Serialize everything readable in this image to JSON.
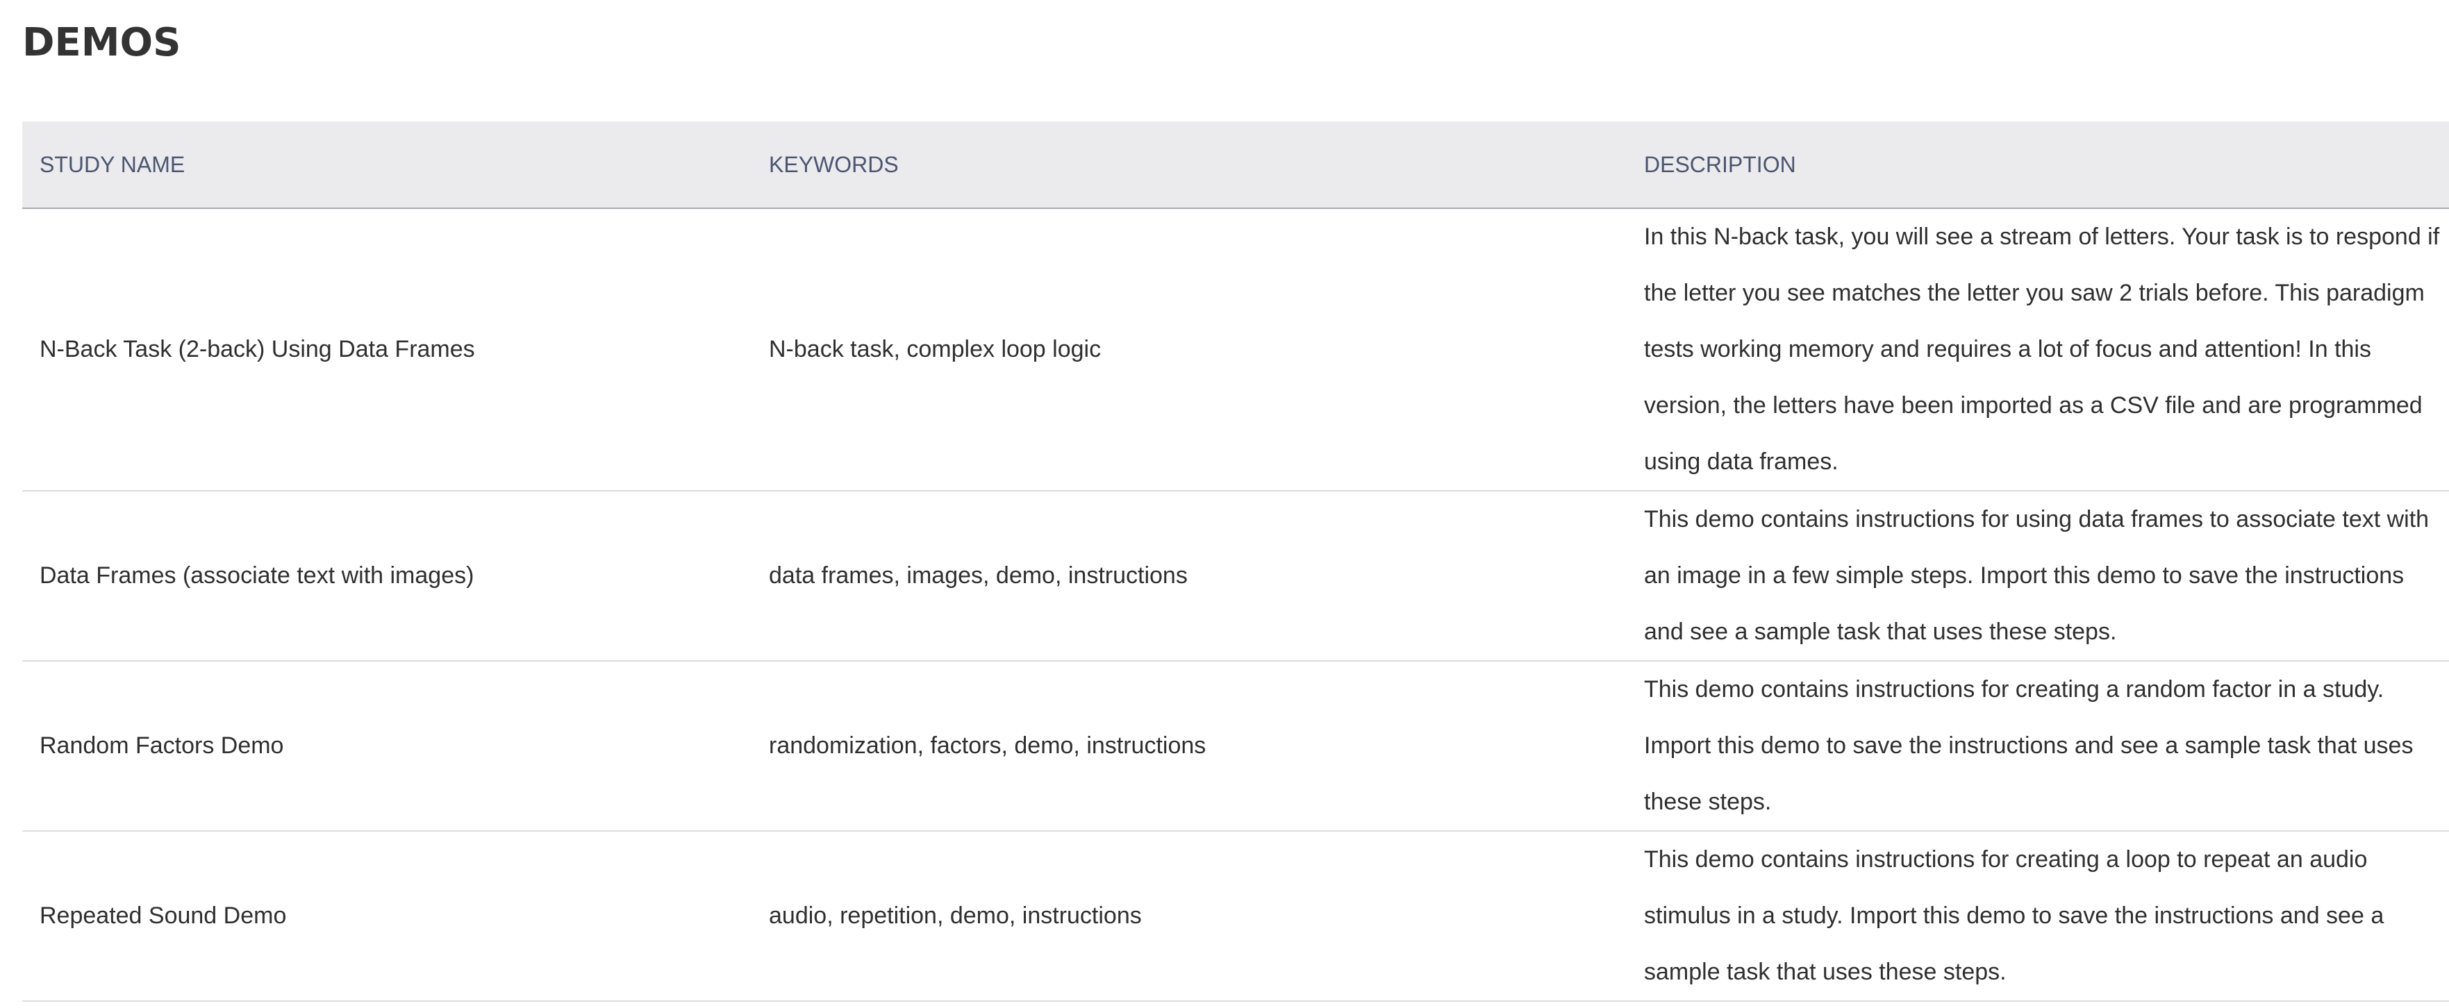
{
  "page": {
    "title": "DEMOS"
  },
  "table": {
    "headers": [
      "STUDY NAME",
      "KEYWORDS",
      "DESCRIPTION"
    ],
    "rows": [
      {
        "name": "N-Back Task (2-back) Using Data Frames",
        "keywords": "N-back task, complex loop logic",
        "description_lines": [
          "In this N-back task, you will see a stream of letters. Your task is to respond if",
          "the letter you see matches the letter you saw 2 trials before. This paradigm",
          "tests working memory and requires a lot of focus and attention! In this",
          "version, the letters have been imported as a CSV file and are programmed",
          "using data frames."
        ]
      },
      {
        "name": "Data Frames (associate text with images)",
        "keywords": "data frames, images, demo, instructions",
        "description_lines": [
          "This demo contains instructions for using data frames to associate text with",
          "an image in a few simple steps. Import this demo to save the instructions",
          "and see a sample task that uses these steps."
        ]
      },
      {
        "name": "Random Factors Demo",
        "keywords": "randomization, factors, demo, instructions",
        "description_lines": [
          "This demo contains instructions for creating a random factor in a study.",
          "Import this demo to save the instructions and see a sample task that uses",
          "these steps."
        ]
      },
      {
        "name": "Repeated Sound Demo",
        "keywords": "audio, repetition, demo, instructions",
        "description_lines": [
          "This demo contains instructions for creating a loop to repeat an audio",
          "stimulus in a study. Import this demo to save the instructions and see a",
          "sample task that uses these steps."
        ]
      }
    ]
  }
}
